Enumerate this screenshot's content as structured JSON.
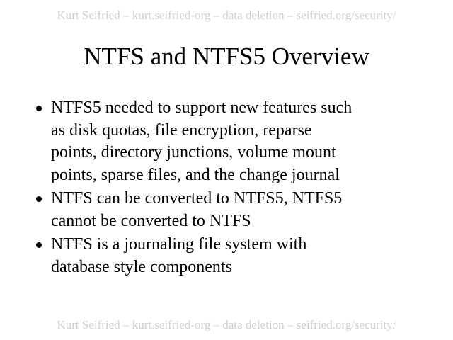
{
  "header": {
    "text": "Kurt Seifried – kurt.seifried-org – data deletion – seifried.org/security/"
  },
  "title": "NTFS and NTFS5 Overview",
  "bullets": [
    {
      "lines": [
        "NTFS5 needed to support new features such",
        "as disk quotas, file encryption, reparse",
        "points, directory junctions, volume mount",
        "points, sparse files, and the change journal"
      ]
    },
    {
      "lines": [
        "NTFS can be converted to NTFS5, NTFS5",
        "cannot be converted to NTFS"
      ]
    },
    {
      "lines": [
        "NTFS is a journaling file system with",
        "database style components"
      ]
    }
  ],
  "footer": {
    "text": "Kurt Seifried – kurt.seifried-org – data deletion – seifried.org/security/"
  }
}
